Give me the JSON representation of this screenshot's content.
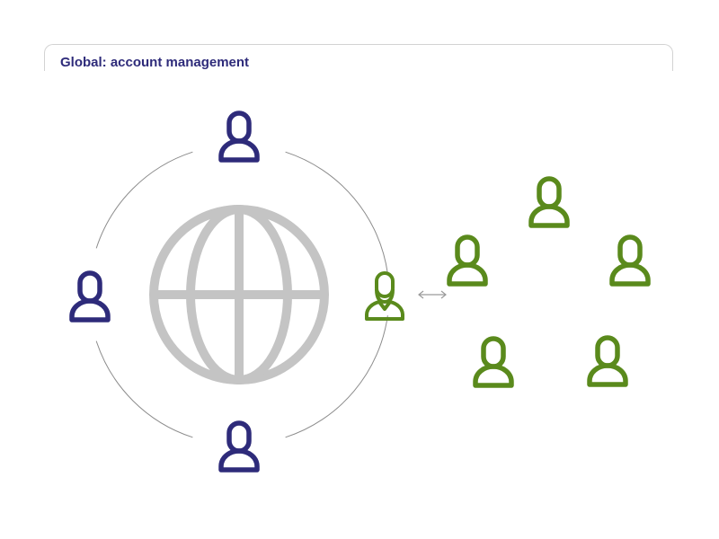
{
  "panel": {
    "title": "Global: account management"
  },
  "colors": {
    "title": "#2e2b7a",
    "global_user": "#2e2b7a",
    "local_user": "#5a8a1c",
    "globe": "#c4c4c4",
    "ring": "#8c8c8c",
    "arrow": "#9a9a9a"
  },
  "diagram": {
    "center_icon": "globe-icon",
    "ring_users": [
      {
        "name": "global-user-top",
        "icon": "user-icon",
        "color": "global_user"
      },
      {
        "name": "global-user-left",
        "icon": "user-icon",
        "color": "global_user"
      },
      {
        "name": "global-user-bottom",
        "icon": "user-icon",
        "color": "global_user"
      },
      {
        "name": "local-admin",
        "icon": "bearded-user-icon",
        "color": "local_user"
      }
    ],
    "connector_icon": "bidirectional-arrow-icon",
    "local_users": [
      {
        "name": "local-user-1",
        "icon": "user-icon",
        "color": "local_user"
      },
      {
        "name": "local-user-2",
        "icon": "user-icon",
        "color": "local_user"
      },
      {
        "name": "local-user-3",
        "icon": "user-icon",
        "color": "local_user"
      },
      {
        "name": "local-user-4",
        "icon": "user-icon",
        "color": "local_user"
      },
      {
        "name": "local-user-5",
        "icon": "user-icon",
        "color": "local_user"
      }
    ]
  }
}
